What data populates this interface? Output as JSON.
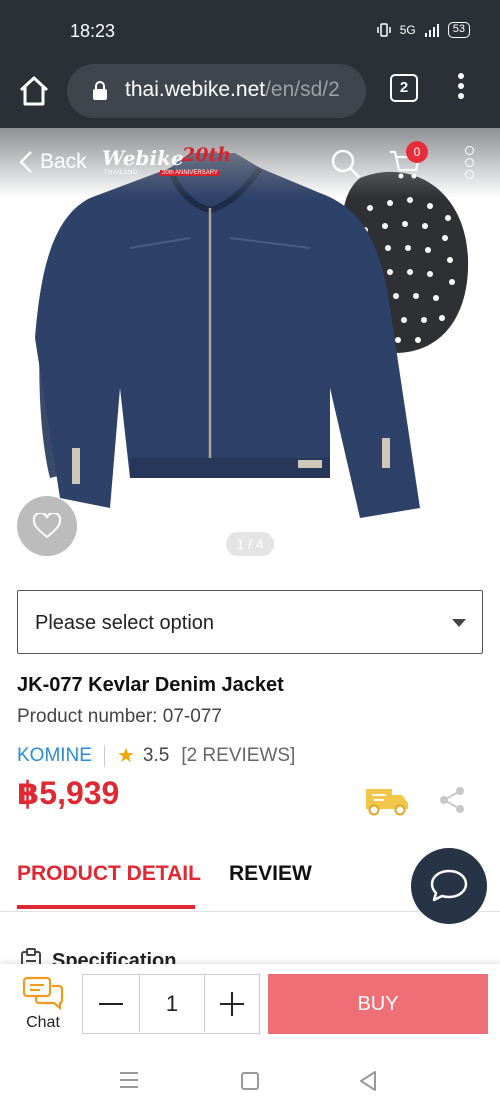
{
  "status_bar": {
    "time": "18:23",
    "signal": "5G",
    "battery": "53"
  },
  "browser": {
    "url_host": "thai.webike.net",
    "url_path": "/en/sd/2",
    "tab_count": "2"
  },
  "header": {
    "back_label": "Back",
    "logo_text": "Webike",
    "logo_anniversary": "20th",
    "logo_region": "THAILAND",
    "logo_tagline": "20th ANNIVERSARY",
    "cart_count": "0"
  },
  "gallery": {
    "pager": "1 / 4"
  },
  "option": {
    "placeholder": "Please select option"
  },
  "product": {
    "title": "JK-077 Kevlar Denim Jacket",
    "number_label": "Product number:",
    "number_value": "07-077",
    "brand": "KOMINE",
    "rating": "3.5",
    "reviews": "[2 REVIEWS]",
    "price": "฿5,939"
  },
  "tabs": [
    {
      "label": "PRODUCT DETAIL",
      "active": true
    },
    {
      "label": "REVIEW",
      "active": false
    }
  ],
  "section": {
    "spec_title": "Specification"
  },
  "buy_bar": {
    "chat_label": "Chat",
    "quantity": "1",
    "buy_label": "BUY"
  },
  "colors": {
    "accent": "#e02833",
    "buy": "#ef6f77",
    "brand_link": "#2a8bd8",
    "fab": "#263446"
  }
}
